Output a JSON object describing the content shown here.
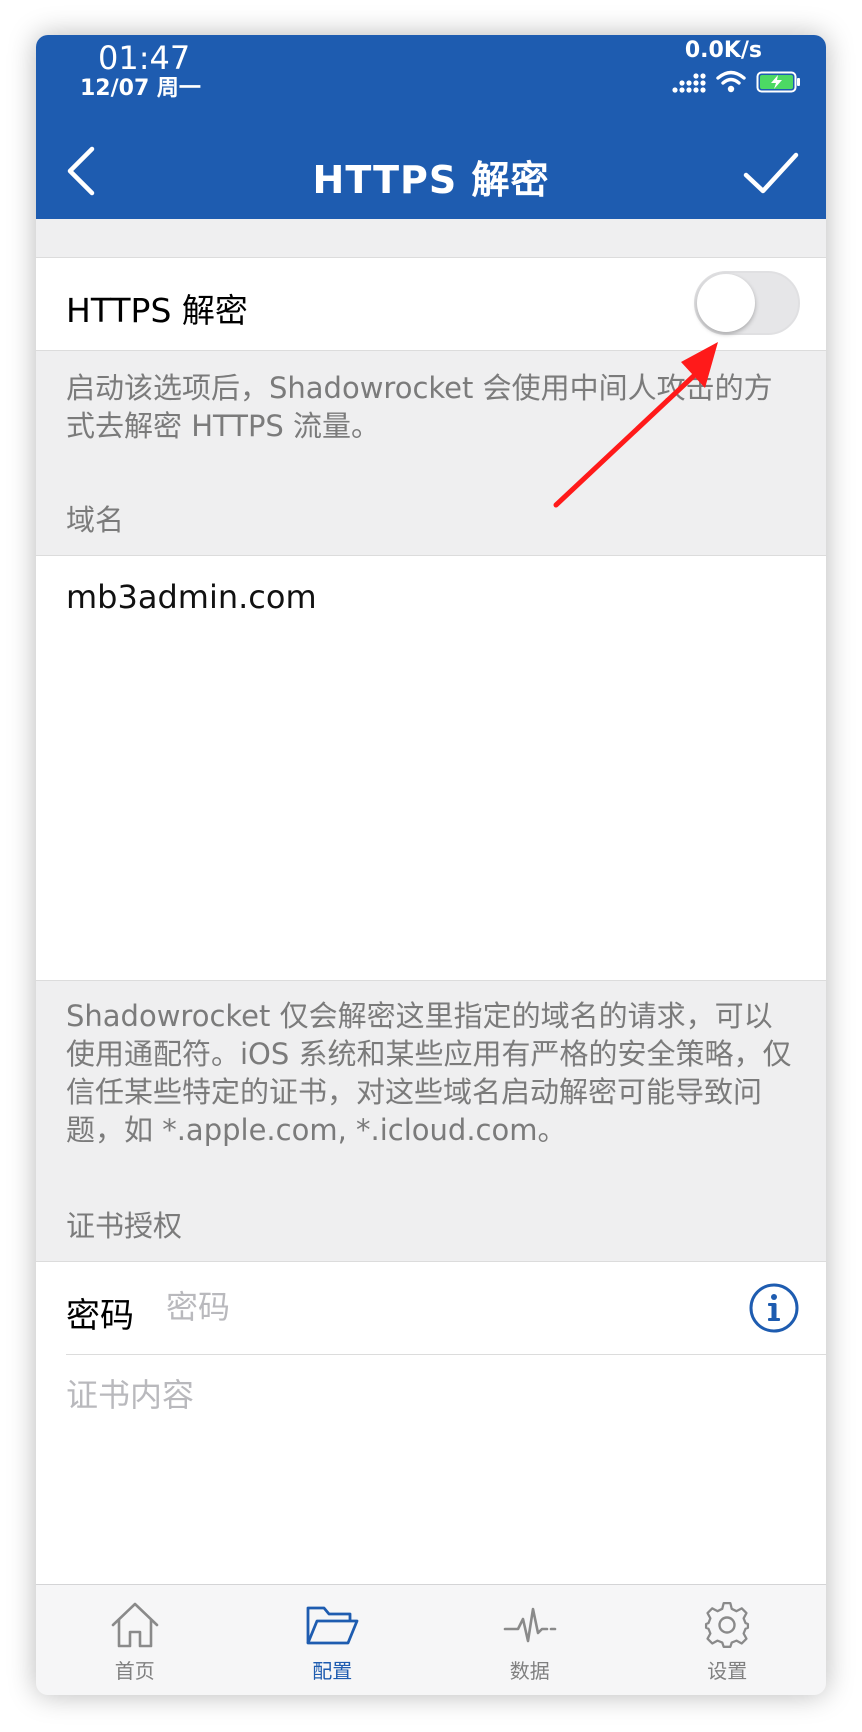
{
  "status_bar": {
    "time": "01:47",
    "date": "12/07 周一",
    "net_speed": "0.0K/s",
    "icons": [
      "signal-icon",
      "wifi-icon",
      "battery-charging-icon"
    ]
  },
  "nav": {
    "title": "HTTPS 解密",
    "back_icon": "chevron-left-icon",
    "done_icon": "checkmark-icon"
  },
  "https_toggle": {
    "label": "HTTPS 解密",
    "enabled": false
  },
  "https_footer": "启动该选项后，Shadowrocket 会使用中间人攻击的方式去解密 HTTPS 流量。",
  "domain_section": {
    "header": "域名",
    "value": "mb3admin.com",
    "footer": "Shadowrocket 仅会解密这里指定的域名的请求，可以使用通配符。iOS 系统和某些应用有严格的安全策略，仅信任某些特定的证书，对这些域名启动解密可能导致问题，如 *.apple.com, *.icloud.com。"
  },
  "cert_section": {
    "header": "证书授权",
    "password_label": "密码",
    "password_placeholder": "密码",
    "password_value": "",
    "info_icon": "info-icon",
    "content_placeholder": "证书内容"
  },
  "tabbar": {
    "items": [
      {
        "label": "首页",
        "icon": "home-icon",
        "active": false
      },
      {
        "label": "配置",
        "icon": "folder-icon",
        "active": true
      },
      {
        "label": "数据",
        "icon": "pulse-icon",
        "active": false
      },
      {
        "label": "设置",
        "icon": "gear-icon",
        "active": false
      }
    ]
  },
  "colors": {
    "accent": "#1e5cb0",
    "background": "#efeff0",
    "annotation_arrow": "#ff1a1a"
  }
}
